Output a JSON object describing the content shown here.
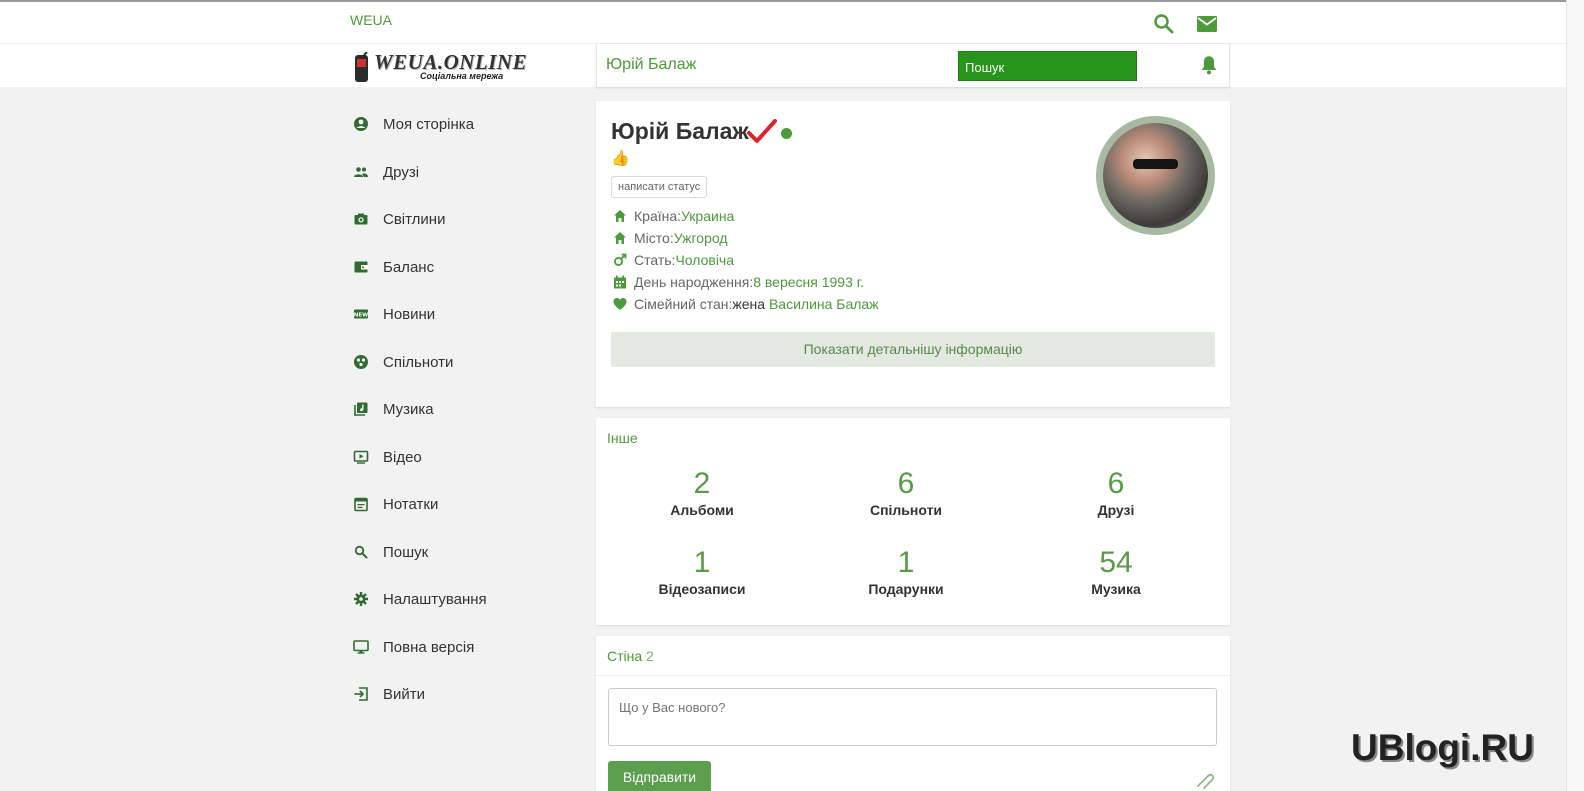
{
  "topbar": {
    "site_name": "WEUA"
  },
  "logo": {
    "text": "WEUA.ONLINE",
    "subtitle": "Соціальна мережа"
  },
  "header": {
    "user_name": "Юрій Балаж",
    "search_label": "Пошук"
  },
  "sidebar": {
    "items": [
      {
        "label": "Моя сторінка",
        "icon": "account-circle-icon"
      },
      {
        "label": "Друзі",
        "icon": "people-icon"
      },
      {
        "label": "Світлини",
        "icon": "camera-icon"
      },
      {
        "label": "Баланс",
        "icon": "wallet-icon"
      },
      {
        "label": "Новини",
        "icon": "news-icon"
      },
      {
        "label": "Спільноти",
        "icon": "community-icon"
      },
      {
        "label": "Музика",
        "icon": "music-library-icon"
      },
      {
        "label": "Відео",
        "icon": "video-icon"
      },
      {
        "label": "Нотатки",
        "icon": "notes-icon"
      },
      {
        "label": "Пошук",
        "icon": "search-icon"
      },
      {
        "label": "Налаштування",
        "icon": "gear-icon"
      },
      {
        "label": "Повна версія",
        "icon": "monitor-icon"
      },
      {
        "label": "Вийти",
        "icon": "logout-icon"
      }
    ]
  },
  "profile": {
    "name": "Юрій Балаж",
    "status_emoji": "👍",
    "write_status_label": "написати статус",
    "country_label": "Країна:",
    "country": "Украина",
    "city_label": "Місто:",
    "city": "Ужгород",
    "gender_label": "Стать:",
    "gender": "Чоловіча",
    "birthday_label": "День народження:",
    "birthday": "8 вересня 1993 г.",
    "family_label": "Сімейний стан:",
    "family_status": "жена",
    "spouse": "Василина Балаж",
    "more_info_label": "Показати детальнішу інформацію"
  },
  "other": {
    "title": "Інше",
    "stats": [
      {
        "value": "2",
        "label": "Альбоми"
      },
      {
        "value": "6",
        "label": "Спільноти"
      },
      {
        "value": "6",
        "label": "Друзі"
      },
      {
        "value": "1",
        "label": "Відеозаписи"
      },
      {
        "value": "1",
        "label": "Подарунки"
      },
      {
        "value": "54",
        "label": "Музика"
      }
    ]
  },
  "wall": {
    "title": "Стіна",
    "count": "2",
    "placeholder": "Що у Вас нового?",
    "send_label": "Відправити"
  },
  "watermark": "UBlogi.RU",
  "colors": {
    "accent": "#4d9a3a",
    "search_button": "#27951a",
    "verified": "#e0202a"
  }
}
